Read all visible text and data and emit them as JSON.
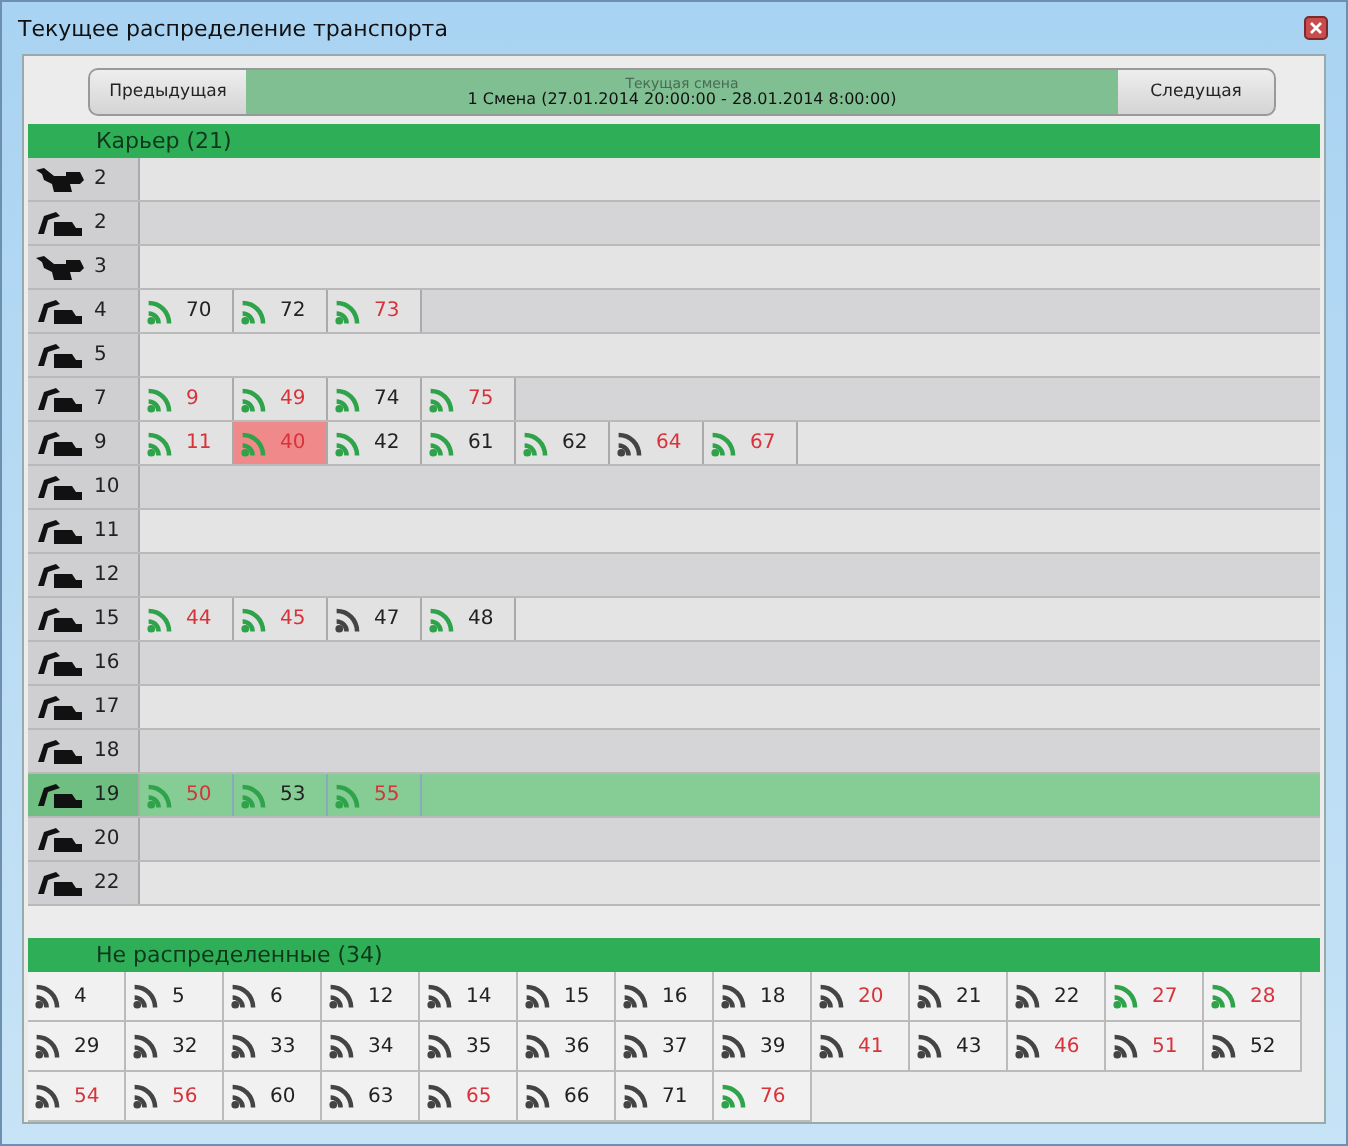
{
  "window": {
    "title": "Текущее распределение транспорта"
  },
  "shift_nav": {
    "previous": "Предыдущая",
    "caption": "Текущая смена",
    "shift": "1 Смена (27.01.2014 20:00:00 - 28.01.2014 8:00:00)",
    "next": "Следущая"
  },
  "pit": {
    "title": "Карьер (21)",
    "rows": [
      {
        "kind": "dragline",
        "number": "2",
        "selected": false,
        "trucks": []
      },
      {
        "kind": "excavator",
        "number": "2",
        "selected": false,
        "trucks": []
      },
      {
        "kind": "dragline",
        "number": "3",
        "selected": false,
        "trucks": []
      },
      {
        "kind": "excavator",
        "number": "4",
        "selected": false,
        "trucks": [
          {
            "number": "70",
            "online": true,
            "alert": false,
            "selected": false
          },
          {
            "number": "72",
            "online": true,
            "alert": false,
            "selected": false
          },
          {
            "number": "73",
            "online": true,
            "alert": true,
            "selected": false
          }
        ]
      },
      {
        "kind": "excavator",
        "number": "5",
        "selected": false,
        "trucks": []
      },
      {
        "kind": "excavator",
        "number": "7",
        "selected": false,
        "trucks": [
          {
            "number": "9",
            "online": true,
            "alert": true,
            "selected": false
          },
          {
            "number": "49",
            "online": true,
            "alert": true,
            "selected": false
          },
          {
            "number": "74",
            "online": true,
            "alert": false,
            "selected": false
          },
          {
            "number": "75",
            "online": true,
            "alert": true,
            "selected": false
          }
        ]
      },
      {
        "kind": "excavator",
        "number": "9",
        "selected": false,
        "trucks": [
          {
            "number": "11",
            "online": true,
            "alert": true,
            "selected": false
          },
          {
            "number": "40",
            "online": true,
            "alert": true,
            "selected": true
          },
          {
            "number": "42",
            "online": true,
            "alert": false,
            "selected": false
          },
          {
            "number": "61",
            "online": true,
            "alert": false,
            "selected": false
          },
          {
            "number": "62",
            "online": true,
            "alert": false,
            "selected": false
          },
          {
            "number": "64",
            "online": false,
            "alert": true,
            "selected": false
          },
          {
            "number": "67",
            "online": true,
            "alert": true,
            "selected": false
          }
        ]
      },
      {
        "kind": "excavator",
        "number": "10",
        "selected": false,
        "trucks": []
      },
      {
        "kind": "excavator",
        "number": "11",
        "selected": false,
        "trucks": []
      },
      {
        "kind": "excavator",
        "number": "12",
        "selected": false,
        "trucks": []
      },
      {
        "kind": "excavator",
        "number": "15",
        "selected": false,
        "trucks": [
          {
            "number": "44",
            "online": true,
            "alert": true,
            "selected": false
          },
          {
            "number": "45",
            "online": true,
            "alert": true,
            "selected": false
          },
          {
            "number": "47",
            "online": false,
            "alert": false,
            "selected": false
          },
          {
            "number": "48",
            "online": true,
            "alert": false,
            "selected": false
          }
        ]
      },
      {
        "kind": "excavator",
        "number": "16",
        "selected": false,
        "trucks": []
      },
      {
        "kind": "excavator",
        "number": "17",
        "selected": false,
        "trucks": []
      },
      {
        "kind": "excavator",
        "number": "18",
        "selected": false,
        "trucks": []
      },
      {
        "kind": "excavator",
        "number": "19",
        "selected": true,
        "trucks": [
          {
            "number": "50",
            "online": true,
            "alert": true,
            "selected": false
          },
          {
            "number": "53",
            "online": true,
            "alert": false,
            "selected": false
          },
          {
            "number": "55",
            "online": true,
            "alert": true,
            "selected": false
          }
        ]
      },
      {
        "kind": "excavator",
        "number": "20",
        "selected": false,
        "trucks": []
      },
      {
        "kind": "excavator",
        "number": "22",
        "selected": false,
        "trucks": []
      }
    ]
  },
  "unassigned": {
    "title": "Не распределенные (34)",
    "trucks": [
      {
        "number": "4",
        "online": false,
        "alert": false,
        "selected": false
      },
      {
        "number": "5",
        "online": false,
        "alert": false,
        "selected": false
      },
      {
        "number": "6",
        "online": false,
        "alert": false,
        "selected": false
      },
      {
        "number": "12",
        "online": false,
        "alert": false,
        "selected": false
      },
      {
        "number": "14",
        "online": false,
        "alert": false,
        "selected": false
      },
      {
        "number": "15",
        "online": false,
        "alert": false,
        "selected": false
      },
      {
        "number": "16",
        "online": false,
        "alert": false,
        "selected": false
      },
      {
        "number": "18",
        "online": false,
        "alert": false,
        "selected": false
      },
      {
        "number": "20",
        "online": false,
        "alert": true,
        "selected": false
      },
      {
        "number": "21",
        "online": false,
        "alert": false,
        "selected": false
      },
      {
        "number": "22",
        "online": false,
        "alert": false,
        "selected": false
      },
      {
        "number": "27",
        "online": true,
        "alert": true,
        "selected": false
      },
      {
        "number": "28",
        "online": true,
        "alert": true,
        "selected": false
      },
      {
        "number": "29",
        "online": false,
        "alert": false,
        "selected": false
      },
      {
        "number": "32",
        "online": false,
        "alert": false,
        "selected": false
      },
      {
        "number": "33",
        "online": false,
        "alert": false,
        "selected": false
      },
      {
        "number": "34",
        "online": false,
        "alert": false,
        "selected": false
      },
      {
        "number": "35",
        "online": false,
        "alert": false,
        "selected": false
      },
      {
        "number": "36",
        "online": false,
        "alert": false,
        "selected": false
      },
      {
        "number": "37",
        "online": false,
        "alert": false,
        "selected": false
      },
      {
        "number": "39",
        "online": false,
        "alert": false,
        "selected": false
      },
      {
        "number": "41",
        "online": false,
        "alert": true,
        "selected": false
      },
      {
        "number": "43",
        "online": false,
        "alert": false,
        "selected": false
      },
      {
        "number": "46",
        "online": false,
        "alert": true,
        "selected": false
      },
      {
        "number": "51",
        "online": false,
        "alert": true,
        "selected": false
      },
      {
        "number": "52",
        "online": false,
        "alert": false,
        "selected": false
      },
      {
        "number": "54",
        "online": false,
        "alert": true,
        "selected": false
      },
      {
        "number": "56",
        "online": false,
        "alert": true,
        "selected": false
      },
      {
        "number": "60",
        "online": false,
        "alert": false,
        "selected": false
      },
      {
        "number": "63",
        "online": false,
        "alert": false,
        "selected": false
      },
      {
        "number": "65",
        "online": false,
        "alert": true,
        "selected": false
      },
      {
        "number": "66",
        "online": false,
        "alert": false,
        "selected": false
      },
      {
        "number": "71",
        "online": false,
        "alert": false,
        "selected": false
      },
      {
        "number": "76",
        "online": true,
        "alert": true,
        "selected": false
      }
    ]
  }
}
